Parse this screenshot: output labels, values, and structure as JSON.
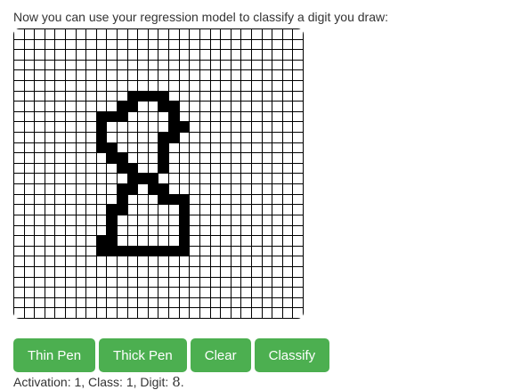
{
  "prompt": "Now you can use your regression model to classify a digit you draw:",
  "canvas": {
    "rows": 28,
    "cols": 28,
    "on_cells": [
      [
        6,
        11
      ],
      [
        6,
        12
      ],
      [
        6,
        13
      ],
      [
        6,
        14
      ],
      [
        7,
        10
      ],
      [
        7,
        11
      ],
      [
        7,
        14
      ],
      [
        7,
        15
      ],
      [
        8,
        8
      ],
      [
        8,
        9
      ],
      [
        8,
        10
      ],
      [
        8,
        15
      ],
      [
        9,
        8
      ],
      [
        9,
        15
      ],
      [
        9,
        16
      ],
      [
        10,
        8
      ],
      [
        10,
        14
      ],
      [
        10,
        15
      ],
      [
        11,
        8
      ],
      [
        11,
        9
      ],
      [
        11,
        14
      ],
      [
        12,
        9
      ],
      [
        12,
        10
      ],
      [
        12,
        14
      ],
      [
        13,
        10
      ],
      [
        13,
        11
      ],
      [
        13,
        14
      ],
      [
        14,
        11
      ],
      [
        14,
        12
      ],
      [
        14,
        13
      ],
      [
        15,
        10
      ],
      [
        15,
        11
      ],
      [
        15,
        13
      ],
      [
        15,
        14
      ],
      [
        16,
        10
      ],
      [
        16,
        14
      ],
      [
        16,
        15
      ],
      [
        16,
        16
      ],
      [
        17,
        9
      ],
      [
        17,
        10
      ],
      [
        17,
        16
      ],
      [
        18,
        9
      ],
      [
        18,
        16
      ],
      [
        19,
        9
      ],
      [
        19,
        16
      ],
      [
        20,
        8
      ],
      [
        20,
        9
      ],
      [
        20,
        16
      ],
      [
        21,
        8
      ],
      [
        21,
        9
      ],
      [
        21,
        10
      ],
      [
        21,
        11
      ],
      [
        21,
        12
      ],
      [
        21,
        13
      ],
      [
        21,
        14
      ],
      [
        21,
        15
      ],
      [
        21,
        16
      ]
    ]
  },
  "buttons": {
    "thin_pen": "Thin Pen",
    "thick_pen": "Thick Pen",
    "clear": "Clear",
    "classify": "Classify"
  },
  "result": {
    "prefix": "Activation: 1, Class: 1, Digit: ",
    "digit": "8",
    "suffix": "."
  },
  "colors": {
    "button_bg": "#4caf50",
    "button_text": "#ffffff",
    "grid_line": "#000000",
    "pixel_on": "#000000"
  }
}
